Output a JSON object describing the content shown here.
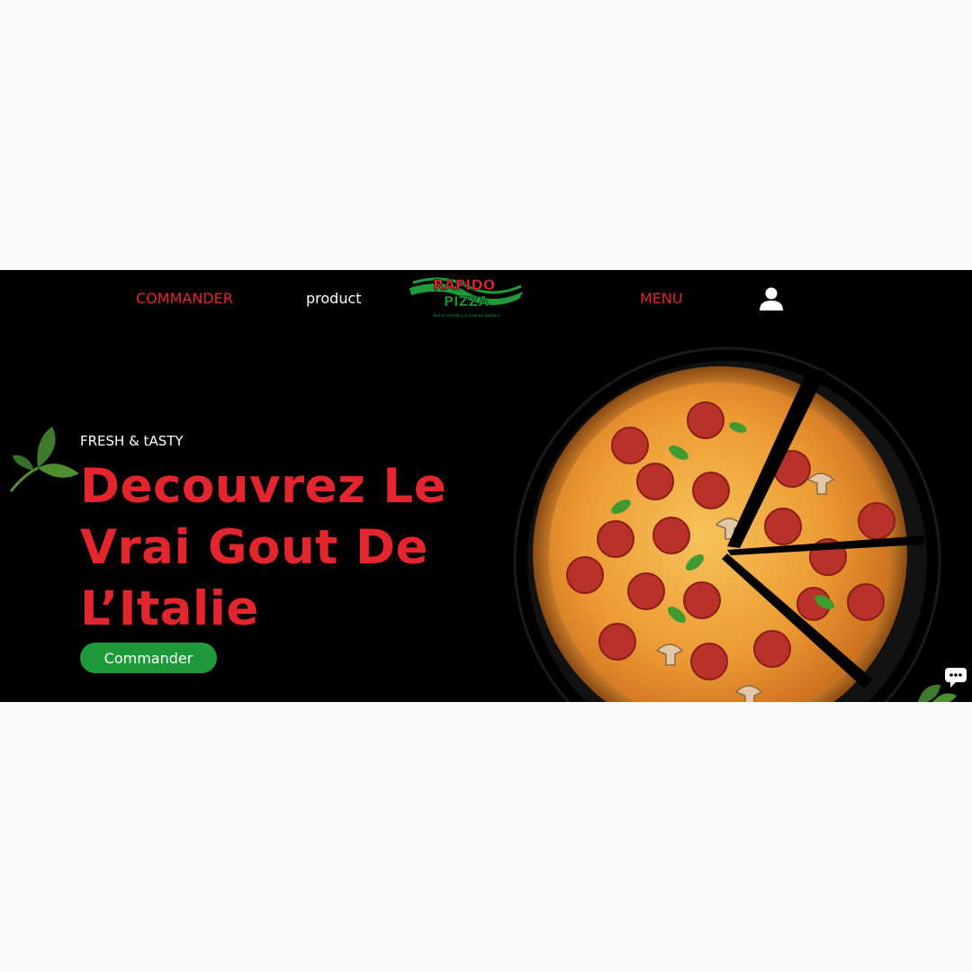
{
  "nav": {
    "commander": "COMMANDER",
    "product": "product",
    "menu": "MENU",
    "user_icon": "user-icon"
  },
  "logo": {
    "line1": "RAPIDO",
    "line2": "PIZZA",
    "slogan": "Tout le monde a le droit au meilleur"
  },
  "hero": {
    "tagline": "FRESH & tASTY",
    "headline_lines": [
      "Decouvrez Le",
      "Vrai Gout De",
      "L’Italie"
    ],
    "cta_label": "Commander"
  },
  "colors": {
    "accent_red": "#e3262d",
    "cta_green": "#1f9a3a",
    "background": "#000000"
  },
  "icons": {
    "leaf": "basil-leaf-icon",
    "chat": "chat-icon"
  }
}
